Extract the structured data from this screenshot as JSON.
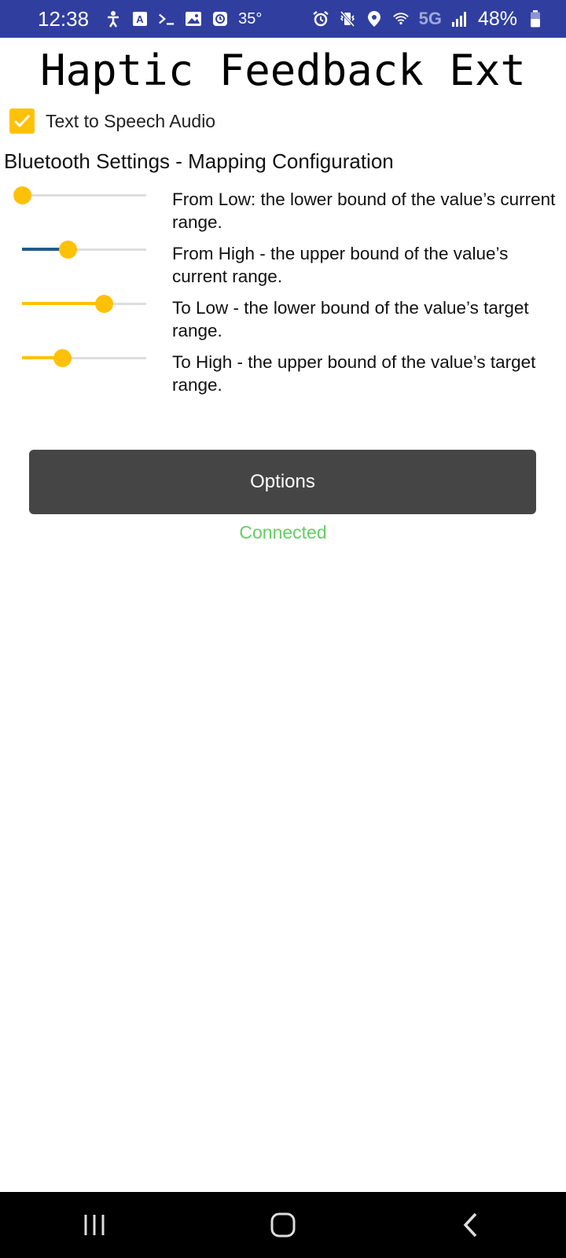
{
  "status_bar": {
    "time": "12:38",
    "temperature": "35°",
    "network": "5G",
    "battery": "48%",
    "left_icons": [
      "accessibility-icon",
      "text-app-icon",
      "terminal-icon",
      "gallery-icon",
      "clock-app-icon"
    ],
    "right_icons": [
      "alarm-icon",
      "vibrate-mute-icon",
      "location-icon",
      "wifi-icon",
      "signal-icon",
      "battery-icon"
    ]
  },
  "app": {
    "title": "Haptic Feedback Ext",
    "tts": {
      "label": "Text to Speech Audio",
      "checked": true
    },
    "section_title": "Bluetooth Settings - Mapping Configuration",
    "sliders": [
      {
        "label": "From Low: the lower bound of the value’s current range.",
        "value": 0.0,
        "fill_color": "#ffc107"
      },
      {
        "label": "From High - the upper bound of the value’s current range.",
        "value": 0.37,
        "fill_color": "#1f5b8c"
      },
      {
        "label": "To Low - the lower bound of the value’s target range.",
        "value": 0.66,
        "fill_color": "#ffc107"
      },
      {
        "label": "To High - the upper bound of the value’s target range.",
        "value": 0.32,
        "fill_color": "#ffc107"
      }
    ],
    "options_button": "Options",
    "connection_status": "Connected"
  },
  "colors": {
    "status_bar": "#303f9f",
    "accent": "#ffc107",
    "button": "#454545",
    "connected": "#66cc66"
  },
  "nav_bar": {
    "buttons": [
      "recent-apps-icon",
      "home-icon",
      "back-icon"
    ]
  }
}
